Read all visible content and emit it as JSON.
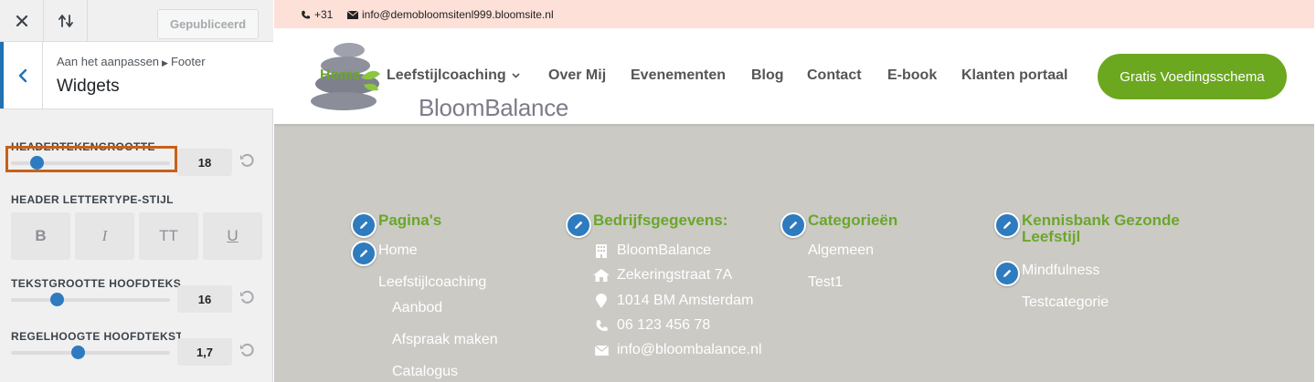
{
  "customizer": {
    "publish_label": "Gepubliceerd",
    "breadcrumb": {
      "prefix": "Aan het aanpassen",
      "parent": "Footer"
    },
    "section_title": "Widgets",
    "controls": {
      "header_font_size": {
        "label": "HEADERTEKENGROOTTE",
        "value": "18",
        "fraction": 0.16
      },
      "header_font_style": {
        "label": "HEADER LETTERTYPE-STIJL",
        "buttons": [
          "B",
          "I",
          "TT",
          "U"
        ]
      },
      "body_font_size": {
        "label": "TEKSTGROOTTE HOOFDTEKST/LINK",
        "value": "16",
        "fraction": 0.29
      },
      "body_line_height": {
        "label": "REGELHOOGTE HOOFDTEKST/LINK",
        "value": "1,7",
        "fraction": 0.42
      }
    }
  },
  "site": {
    "topbar": {
      "phone": "+31",
      "email": "info@demobloomsitenl999.bloomsite.nl"
    },
    "logo_text": "BloomBalance",
    "nav": [
      "Home",
      "Leefstijlcoaching",
      "Over Mij",
      "Evenementen",
      "Blog",
      "Contact",
      "E-book",
      "Klanten portaal"
    ],
    "cta_label": "Gratis Voedingsschema",
    "footer": {
      "pages": {
        "title": "Pagina's",
        "links": [
          "Home",
          "Leefstijlcoaching",
          "Aanbod",
          "Afspraak maken",
          "Catalogus"
        ]
      },
      "company": {
        "title": "Bedrijfsgegevens:",
        "rows": [
          {
            "icon": "building-icon",
            "text": "BloomBalance"
          },
          {
            "icon": "home-icon",
            "text": "Zekeringstraat 7A"
          },
          {
            "icon": "map-pin-icon",
            "text": "1014 BM Amsterdam"
          },
          {
            "icon": "phone-icon",
            "text": "06 123 456 78"
          },
          {
            "icon": "envelope-icon",
            "text": "info@bloombalance.nl"
          }
        ]
      },
      "categories": {
        "title": "Categorieën",
        "links": [
          "Algemeen",
          "Test1"
        ]
      },
      "knowledge": {
        "title": "Kennisbank Gezonde Leefstijl",
        "links": [
          "Mindfulness",
          "Testcategorie"
        ]
      }
    }
  },
  "colors": {
    "accent_green": "#6ca720",
    "wp_blue": "#2271b1",
    "highlight_orange": "#c5621a",
    "footer_bg": "#cbcac5",
    "topbar_bg": "#fde0d7"
  }
}
